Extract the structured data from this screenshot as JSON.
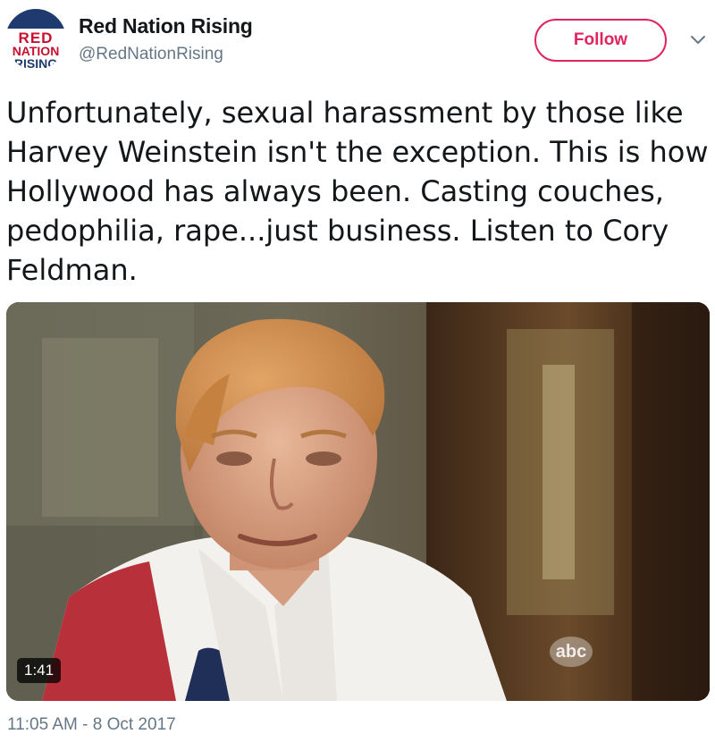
{
  "account": {
    "display_name": "Red Nation Rising",
    "handle": "@RedNationRising",
    "avatar_text": [
      "RED",
      "NATION",
      "RISING"
    ]
  },
  "follow_button": {
    "label": "Follow"
  },
  "tweet": {
    "text": "Unfortunately, sexual harassment by those like Harvey Weinstein isn't the exception. This is how Hollywood has always been. Casting couches, pedophilia, rape...just business. Listen to Cory Feldman.",
    "timestamp": "11:05 AM - 8 Oct 2017"
  },
  "video": {
    "duration": "1:41",
    "watermark": "abc"
  },
  "icons": {
    "more": "chevron-down-icon"
  },
  "colors": {
    "follow_accent": "#e0245e",
    "text_primary": "#14171a",
    "text_secondary": "#657786",
    "avatar_red": "#c8102e",
    "avatar_blue": "#1f3a6e"
  }
}
